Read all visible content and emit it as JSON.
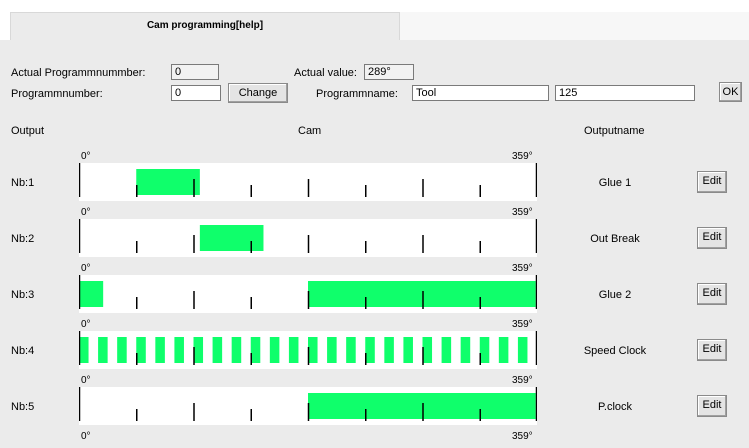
{
  "tab": {
    "title": "Cam programming[help]"
  },
  "form": {
    "actual_program_label": "Actual Programmnummber:",
    "actual_program_value": "0",
    "actual_value_label": "Actual value:",
    "actual_value": "289°",
    "program_number_label": "Programmnumber:",
    "program_number_value": "0",
    "change_button": "Change",
    "program_name_label": "Programmname:",
    "program_name_value": "Tool",
    "extra_value": "125",
    "ok_button": "OK"
  },
  "headers": {
    "output": "Output",
    "cam": "Cam",
    "outputname": "Outputname"
  },
  "scale": {
    "start": "0°",
    "end": "359°"
  },
  "colors": {
    "cam_on": "#0fff6b",
    "track_bg": "#ffffff",
    "panel_bg": "#ebebeb"
  },
  "outputs": [
    {
      "nb": "Nb:1",
      "name": "Glue 1",
      "edit": "Edit",
      "segments": [
        [
          45,
          95
        ]
      ]
    },
    {
      "nb": "Nb:2",
      "name": "Out Break",
      "edit": "Edit",
      "segments": [
        [
          95,
          145
        ]
      ]
    },
    {
      "nb": "Nb:3",
      "name": "Glue 2",
      "edit": "Edit",
      "segments": [
        [
          0,
          19
        ],
        [
          180,
          359
        ]
      ]
    },
    {
      "nb": "Nb:4",
      "name": "Speed Clock",
      "edit": "Edit",
      "pulses": {
        "count": 24,
        "duty": 0.5
      }
    },
    {
      "nb": "Nb:5",
      "name": "P.clock",
      "edit": "Edit",
      "segments": [
        [
          180,
          359
        ]
      ]
    }
  ]
}
